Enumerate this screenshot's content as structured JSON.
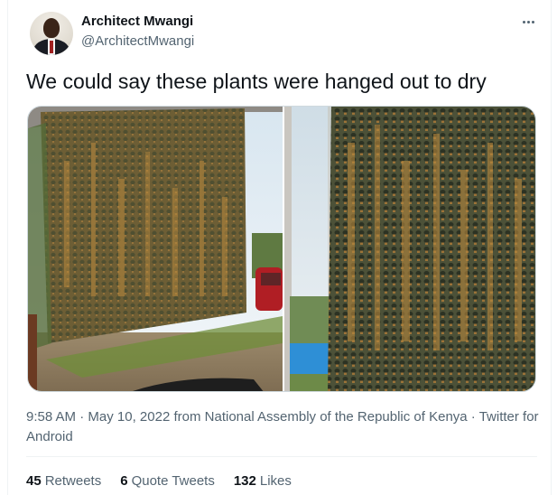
{
  "author": {
    "display_name": "Architect Mwangi",
    "handle": "@ArchitectMwangi"
  },
  "more_icon": "more-horizontal-icon",
  "tweet": {
    "text": "We could say these plants were hanged out to dry"
  },
  "media": {
    "photos": [
      "left-photo",
      "right-photo"
    ]
  },
  "meta": {
    "time": "9:58 AM",
    "separator1": " · ",
    "date": "May 10, 2022",
    "from_text": " from ",
    "location": "National Assembly of the Republic of Kenya",
    "separator2": " · ",
    "source": "Twitter for Android"
  },
  "stats": {
    "retweets_count": "45",
    "retweets_label": "Retweets",
    "quotes_count": "6",
    "quotes_label": "Quote Tweets",
    "likes_count": "132",
    "likes_label": "Likes"
  },
  "colors": {
    "text_primary": "#0f1419",
    "text_secondary": "#536471",
    "border": "#cfd9de",
    "divider": "#eff3f4"
  }
}
